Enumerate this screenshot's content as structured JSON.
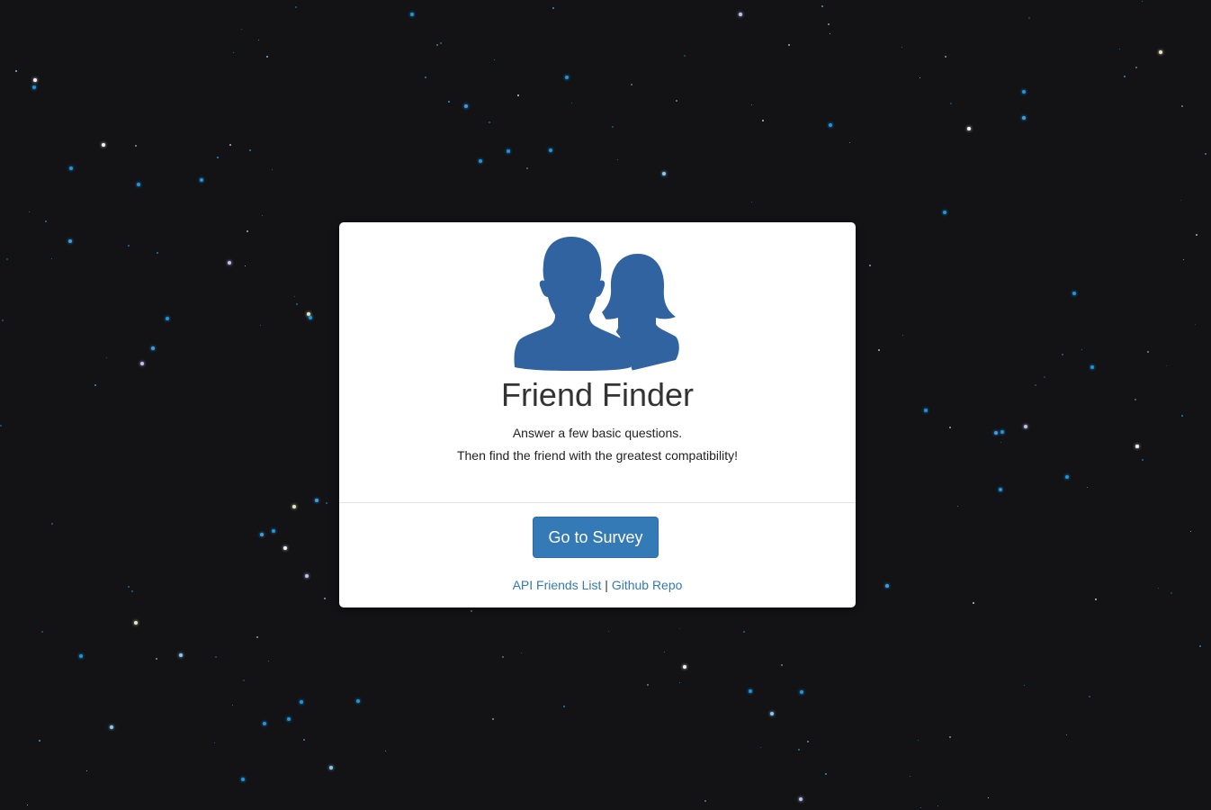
{
  "colors": {
    "background": "#131315",
    "accent": "#337ab7",
    "card": "#ffffff"
  },
  "logo": {
    "icon": "two-people-icon",
    "color": "#3163a0"
  },
  "card": {
    "title": "Friend Finder",
    "subtitle_line1": "Answer a few basic questions.",
    "subtitle_line2": "Then find the friend with the greatest compatibility!"
  },
  "footer": {
    "survey_button_label": "Go to Survey",
    "api_link_label": "API Friends List",
    "separator": "|",
    "github_link_label": "Github Repo"
  }
}
